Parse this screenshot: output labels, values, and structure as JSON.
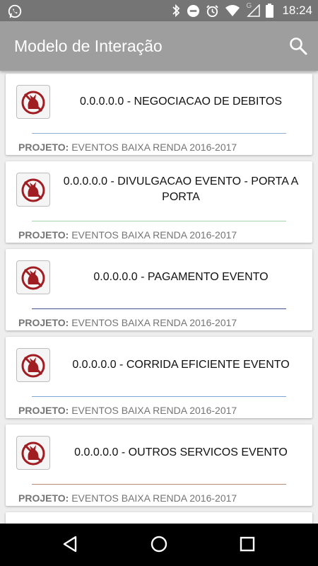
{
  "status_bar": {
    "time": "18:24",
    "icons": [
      "whatsapp-icon",
      "bluetooth-icon",
      "do-not-disturb-icon",
      "alarm-icon",
      "wifi-icon",
      "signal-icon",
      "battery-icon"
    ],
    "network_letter": "G"
  },
  "app_bar": {
    "title": "Modelo de Interação",
    "search_icon": "search-icon"
  },
  "cards": [
    {
      "title": "0.0.0.0.0 - NEGOCIACAO DE DEBITOS",
      "project_label": "PROJETO:",
      "project_value": "EVENTOS BAIXA RENDA 2016-2017",
      "accent": "#90b0d8"
    },
    {
      "title": "0.0.0.0.0 - DIVULGACAO EVENTO - PORTA A PORTA",
      "project_label": "PROJETO:",
      "project_value": "EVENTOS BAIXA RENDA 2016-2017",
      "accent": "#a5d6a7"
    },
    {
      "title": "0.0.0.0.0 - PAGAMENTO EVENTO",
      "project_label": "PROJETO:",
      "project_value": "EVENTOS BAIXA RENDA 2016-2017",
      "accent": "#3f4f8f"
    },
    {
      "title": "0.0.0.0.0 - CORRIDA EFICIENTE EVENTO",
      "project_label": "PROJETO:",
      "project_value": "EVENTOS BAIXA RENDA 2016-2017",
      "accent": "#7fa6d6"
    },
    {
      "title": "0.0.0.0.0 - OUTROS SERVICOS EVENTO",
      "project_label": "PROJETO:",
      "project_value": "EVENTOS BAIXA RENDA 2016-2017",
      "accent": "#b58a78"
    }
  ],
  "logo_colors": {
    "primary": "#a01d22"
  },
  "nav_bar": {
    "back_icon": "back-triangle-icon",
    "home_icon": "home-circle-icon",
    "recents_icon": "recents-square-icon"
  }
}
